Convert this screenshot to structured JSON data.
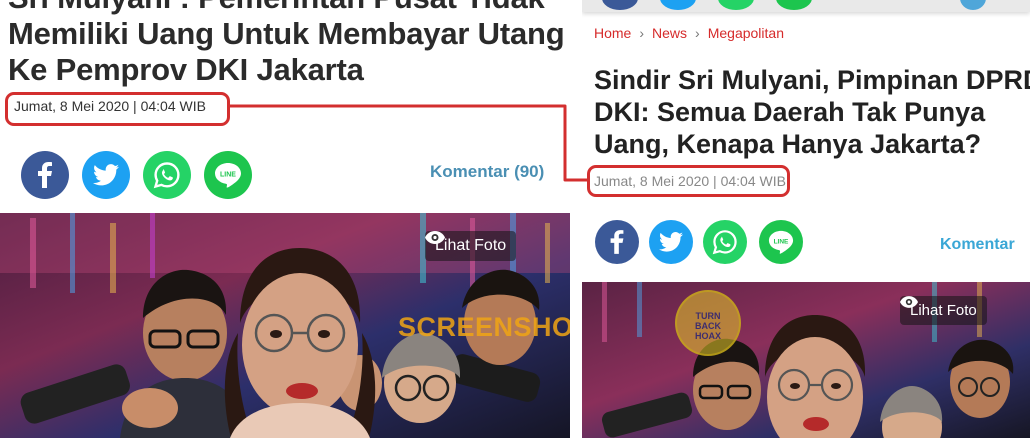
{
  "left": {
    "title_lines": [
      "Sri Mulyani : Pemerintah Pusat Tidak",
      "Memiliki Uang Untuk Membayar Utang",
      "Ke Pemprov DKI Jakarta"
    ],
    "date": "Jumat, 8 Mei 2020 | 04:04 WIB",
    "share_icons": [
      "facebook-icon",
      "twitter-icon",
      "whatsapp-icon",
      "line-icon"
    ],
    "line_label": "LINE",
    "comment": "Komentar (90)",
    "photo_button": "Lihat Foto",
    "watermark": "SCREENSHOT BY"
  },
  "right": {
    "breadcrumb": [
      "Home",
      "News",
      "Megapolitan"
    ],
    "breadcrumb_separator": "›",
    "title_lines": [
      "Sindir Sri Mulyani, Pimpinan DPRD",
      "DKI: Semua Daerah Tak Punya",
      "Uang, Kenapa Hanya Jakarta?"
    ],
    "date": "Jumat, 8 Mei 2020 | 04:04 WIB",
    "share_icons": [
      "facebook-icon",
      "twitter-icon",
      "whatsapp-icon",
      "line-icon"
    ],
    "line_label": "LINE",
    "comment": "Komentar",
    "photo_button": "Lihat Foto",
    "badge_text": "TURN BACK HOAX"
  },
  "colors": {
    "highlight": "#d32f2f",
    "facebook": "#3b5998",
    "twitter": "#1da1f2",
    "whatsapp": "#25d366",
    "line": "#1dc54e",
    "breadcrumb": "#d62b2b"
  }
}
